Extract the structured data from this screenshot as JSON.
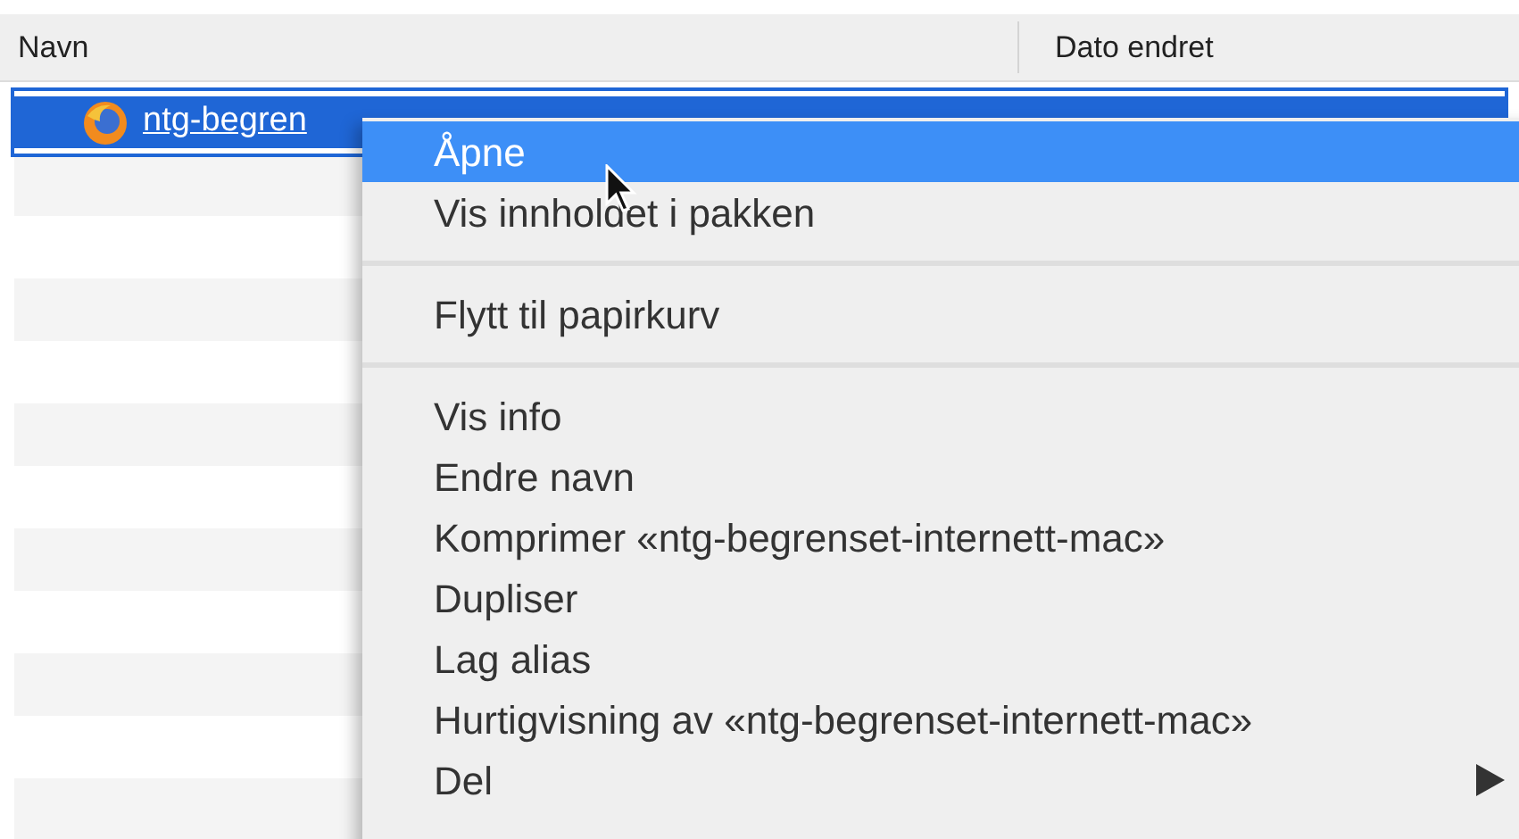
{
  "table": {
    "columns": [
      "Navn",
      "Dato endret"
    ],
    "rows": [
      {
        "name": "ntg-begren",
        "selected": true
      },
      {
        "selected": false
      },
      {
        "selected": false
      },
      {
        "selected": false
      },
      {
        "selected": false
      },
      {
        "selected": false
      },
      {
        "selected": false
      },
      {
        "selected": false
      },
      {
        "selected": false
      },
      {
        "selected": false
      },
      {
        "selected": false
      },
      {
        "selected": false
      }
    ]
  },
  "context_menu": {
    "items": [
      {
        "kind": "item",
        "label": "Åpne",
        "selected": true,
        "submenu": false
      },
      {
        "kind": "item",
        "label": "Vis innholdet i pakken",
        "selected": false,
        "submenu": false
      },
      {
        "kind": "separator"
      },
      {
        "kind": "item",
        "label": "Flytt til papirkurv",
        "selected": false,
        "submenu": false
      },
      {
        "kind": "separator"
      },
      {
        "kind": "item",
        "label": "Vis info",
        "selected": false,
        "submenu": false
      },
      {
        "kind": "item",
        "label": "Endre navn",
        "selected": false,
        "submenu": false
      },
      {
        "kind": "item",
        "label": "Komprimer «ntg-begrenset-internett-mac»",
        "selected": false,
        "submenu": false
      },
      {
        "kind": "item",
        "label": "Dupliser",
        "selected": false,
        "submenu": false
      },
      {
        "kind": "item",
        "label": "Lag alias",
        "selected": false,
        "submenu": false
      },
      {
        "kind": "item",
        "label": "Hurtigvisning av «ntg-begrenset-internett-mac»",
        "selected": false,
        "submenu": false
      },
      {
        "kind": "item",
        "label": "Del",
        "selected": false,
        "submenu": true
      }
    ]
  }
}
